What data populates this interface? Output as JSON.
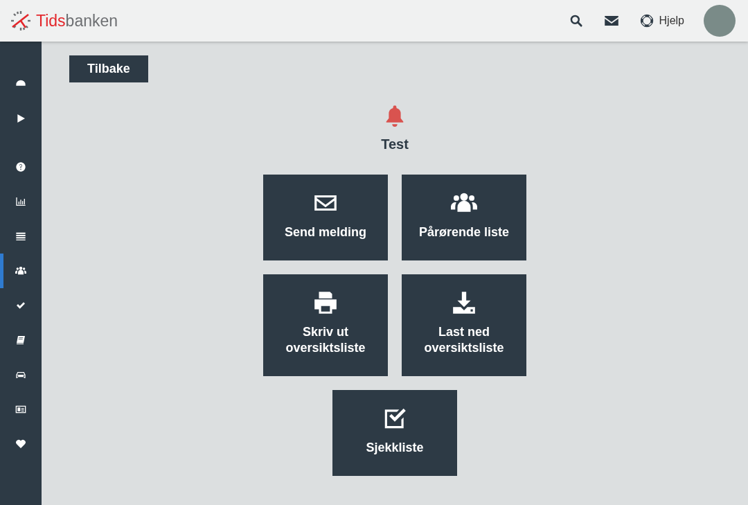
{
  "header": {
    "logo": {
      "part_1": "Tids",
      "part_2": "banken"
    },
    "help_label": "Hjelp"
  },
  "sidebar": {
    "top_items": [
      {
        "kind": "dashboard",
        "selected": false
      },
      {
        "kind": "play",
        "selected": false
      }
    ],
    "items": [
      {
        "kind": "help",
        "selected": false
      },
      {
        "kind": "chart",
        "selected": false
      },
      {
        "kind": "list",
        "selected": false
      },
      {
        "kind": "users",
        "selected": true
      },
      {
        "kind": "check",
        "selected": false
      },
      {
        "kind": "book",
        "selected": false
      },
      {
        "kind": "car",
        "selected": false
      },
      {
        "kind": "card",
        "selected": false
      },
      {
        "kind": "heart",
        "selected": false
      }
    ]
  },
  "back_button": "Tilbake",
  "title": "Test",
  "tiles": [
    {
      "kind": "envelope",
      "label": "Send melding"
    },
    {
      "kind": "users",
      "label": "Pårørende liste"
    },
    {
      "kind": "print",
      "label": "Skriv ut oversiktsliste"
    },
    {
      "kind": "download",
      "label": "Last ned oversiktsliste"
    },
    {
      "kind": "checkbox",
      "label": "Sjekkliste"
    }
  ]
}
